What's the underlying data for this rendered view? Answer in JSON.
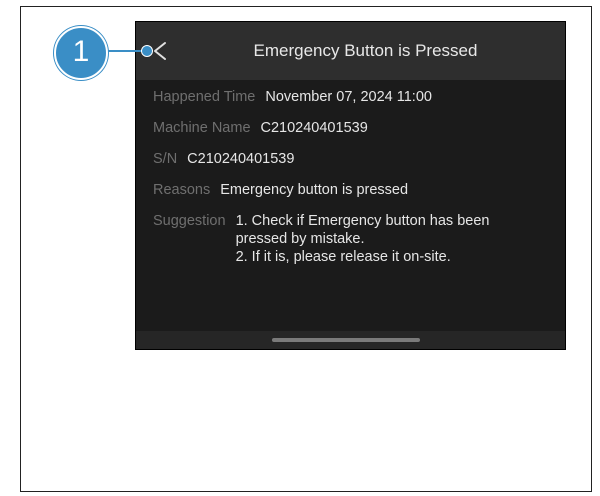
{
  "header": {
    "title": "Emergency Button is Pressed"
  },
  "callout": {
    "number": "1"
  },
  "details": {
    "happened_time_label": "Happened Time",
    "happened_time_value": "November 07, 2024 11:00",
    "machine_name_label": "Machine Name",
    "machine_name_value": "C210240401539",
    "sn_label": "S/N",
    "sn_value": "C210240401539",
    "reasons_label": "Reasons",
    "reasons_value": "Emergency button is pressed",
    "suggestion_label": "Suggestion",
    "suggestion_lines": [
      "1. Check if Emergency button has been",
      "pressed by mistake.",
      "2. If it is, please release it on-site."
    ]
  },
  "icons": {
    "back": "back-chevron-icon"
  },
  "colors": {
    "callout": "#3a8ec6",
    "background": "#1b1b1b",
    "header": "#2e2e2e"
  }
}
